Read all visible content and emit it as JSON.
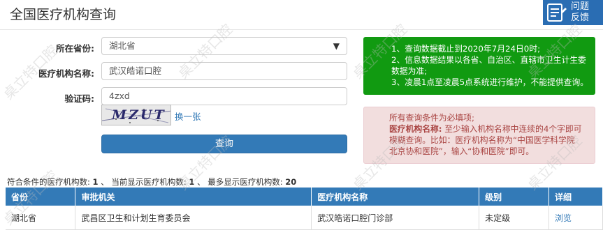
{
  "header": {
    "title": "全国医疗机构查询",
    "feedback_line1": "问题",
    "feedback_line2": "反馈"
  },
  "form": {
    "province_label": "所在省份:",
    "province_value": "湖北省",
    "institution_label": "医疗机构名称:",
    "institution_value": "武汉皓诺口腔",
    "captcha_label": "验证码:",
    "captcha_value": "4zxd",
    "captcha_image_text": "MZUT",
    "refresh_link": "换一张",
    "query_button": "查询"
  },
  "notices": {
    "green": [
      "1、查询数据截止到2020年7月24日0时;",
      "2、信息数据结果以各省、自治区、直辖市卫生计生委",
      "数据为准;",
      "3、凌晨1点至凌晨5点系统进行维护，不能提供查询。"
    ],
    "red": {
      "line1": "所有查询条件为必填项;",
      "bold_label": "医疗机构名称:",
      "line2_rest": "至少输入机构名称中连续的4个字即可",
      "line3": "模糊查询。比如：医疗机构名称为“中国医学科学院",
      "line4": "北京协和医院”，输入“协和医院”即可。"
    }
  },
  "summary": {
    "matched_label": "符合条件的医疗机构数:",
    "matched_count": "1",
    "sep1": "、",
    "current_label": "当前显示医疗机构数:",
    "current_count": "1",
    "sep2": "、",
    "max_label": "最多显示医疗机构数:",
    "max_count": "20"
  },
  "table": {
    "headers": [
      "省份",
      "审批机关",
      "医疗机构名称",
      "级别",
      "详细"
    ],
    "rows": [
      [
        "湖北省",
        "武昌区卫生和计划生育委员会",
        "武汉皓诺口腔门诊部",
        "未定级",
        "浏览"
      ]
    ]
  },
  "watermark": {
    "text": "桌立特口腔"
  },
  "colors": {
    "primary": "#337ab7",
    "notice_green": "#119a11",
    "notice_red_bg": "#f2dede",
    "notice_red_text": "#a94442"
  }
}
